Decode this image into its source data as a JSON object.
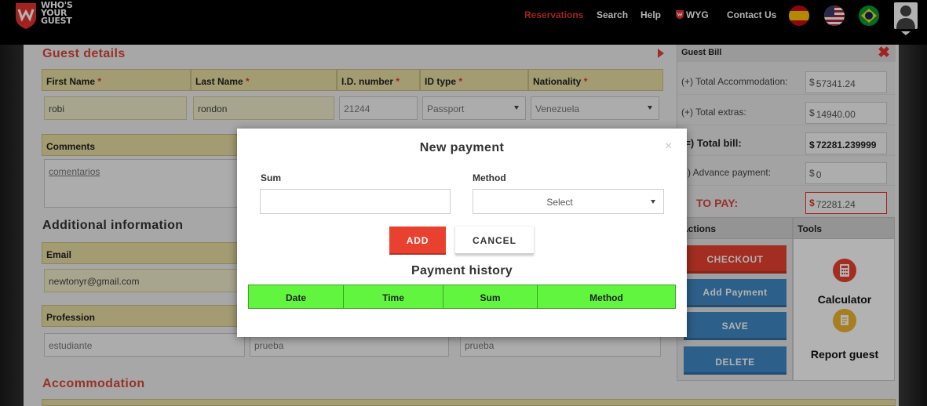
{
  "brand": {
    "logo_text": "WHO'S YOUR GUEST"
  },
  "nav": {
    "reservations": "Reservations",
    "search": "Search",
    "help": "Help",
    "wyg": "WYG",
    "contact": "Contact Us",
    "active_color": "#e8322f"
  },
  "guest_details": {
    "title": "Guest details",
    "headers": {
      "first_name": "First Name",
      "last_name": "Last Name",
      "id_number": "I.D. number",
      "id_type": "ID type",
      "nationality": "Nationality",
      "required_mark": "*"
    },
    "values": {
      "first_name": "robi",
      "last_name": "rondon",
      "id_number": "21244",
      "id_type": "Passport",
      "nationality": "Venezuela"
    },
    "comments_label": "Comments",
    "comments_value": "comentarios"
  },
  "additional_info": {
    "title": "Additional information",
    "email_label": "Email",
    "email_value": "newtonyr@gmail.com",
    "profession_label": "Profession",
    "profession_value": "estudiante",
    "field2_value": "prueba",
    "field3_value": "prueba"
  },
  "accommodation": {
    "title": "Accommodation"
  },
  "guest_bill": {
    "title": "Guest Bill",
    "currency": "$",
    "accommodation_label": "(+) Total Accommodation:",
    "accommodation_value": "57341.24",
    "extras_label": "(+) Total extras:",
    "extras_value": "14940.00",
    "total_label": "(=) Total bill:",
    "total_value": "72281.239999",
    "advance_label": "(-) Advance payment:",
    "advance_value": "0",
    "to_pay_label": "TO PAY:",
    "to_pay_value": "72281.24"
  },
  "actions": {
    "title": "Actions",
    "checkout": "CHECKOUT",
    "add_payment": "Add Payment",
    "save": "SAVE",
    "delete": "DELETE"
  },
  "tools": {
    "title": "Tools",
    "calculator": "Calculator",
    "report": "Report guest"
  },
  "modal": {
    "title": "New payment",
    "close": "×",
    "sum_label": "Sum",
    "sum_value": "",
    "method_label": "Method",
    "method_selected": "Select",
    "add_button": "ADD",
    "cancel_button": "CANCEL",
    "history_title": "Payment history",
    "history_columns": [
      "Date",
      "Time",
      "Sum",
      "Method"
    ]
  }
}
